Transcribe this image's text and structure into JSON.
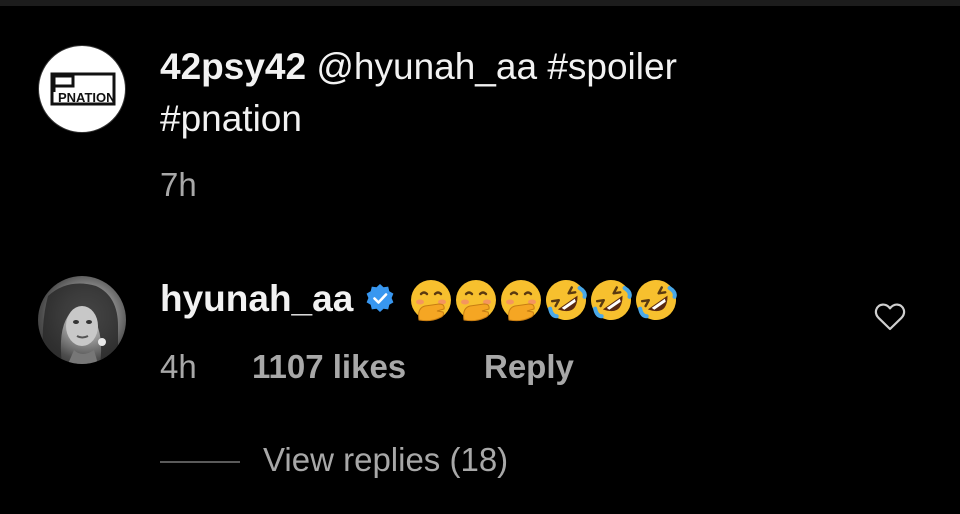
{
  "comments": [
    {
      "avatar_label": "PNATION",
      "username": "42psy42",
      "text_line1": " @hyunah_aa #spoiler",
      "text_line2": "#pnation",
      "time": "7h"
    },
    {
      "username": "hyunah_aa",
      "verified": true,
      "emojis": [
        "hand-over-mouth",
        "hand-over-mouth",
        "hand-over-mouth",
        "rolling-laughing",
        "rolling-laughing",
        "rolling-laughing"
      ],
      "time": "4h",
      "likes": "1107 likes",
      "reply_label": "Reply",
      "view_replies": "View replies (18)"
    }
  ],
  "colors": {
    "background": "#000000",
    "text": "#f2f2f2",
    "muted": "#a8a8a8",
    "verified": "#3897f0",
    "emoji_yellow": "#f7c02e"
  },
  "icons": {
    "verified": "verified-badge-icon",
    "like": "heart-outline-icon"
  }
}
